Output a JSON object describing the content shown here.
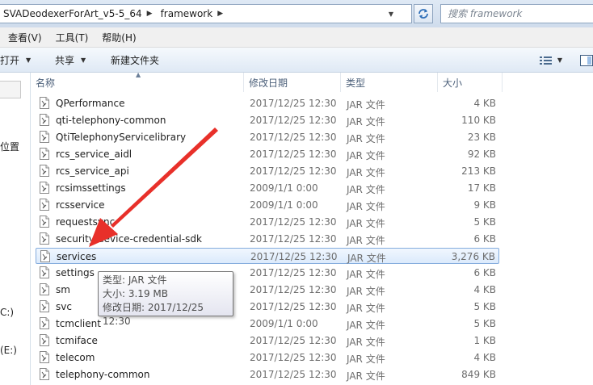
{
  "address": {
    "segments": [
      "SVADeodexerForArt_v5-5_64",
      "framework"
    ],
    "search_placeholder": "搜索 framework"
  },
  "menu": [
    "查看(V)",
    "工具(T)",
    "帮助(H)"
  ],
  "toolbar": {
    "open_label": "打开",
    "share_label": "共享",
    "new_folder_label": "新建文件夹"
  },
  "nav": {
    "partial_labels": [
      "位置",
      "C:)",
      "(E:)"
    ]
  },
  "columns": {
    "name": "名称",
    "date": "修改日期",
    "type": "类型",
    "size": "大小"
  },
  "files": [
    {
      "name": "QPerformance",
      "date": "2017/12/25 12:30",
      "type": "JAR 文件",
      "size": "4 KB"
    },
    {
      "name": "qti-telephony-common",
      "date": "2017/12/25 12:30",
      "type": "JAR 文件",
      "size": "110 KB"
    },
    {
      "name": "QtiTelephonyServicelibrary",
      "date": "2017/12/25 12:30",
      "type": "JAR 文件",
      "size": "23 KB"
    },
    {
      "name": "rcs_service_aidl",
      "date": "2017/12/25 12:30",
      "type": "JAR 文件",
      "size": "92 KB"
    },
    {
      "name": "rcs_service_api",
      "date": "2017/12/25 12:30",
      "type": "JAR 文件",
      "size": "213 KB"
    },
    {
      "name": "rcsimssettings",
      "date": "2009/1/1 0:00",
      "type": "JAR 文件",
      "size": "17 KB"
    },
    {
      "name": "rcsservice",
      "date": "2009/1/1 0:00",
      "type": "JAR 文件",
      "size": "9 KB"
    },
    {
      "name": "requestsync",
      "date": "2017/12/25 12:30",
      "type": "JAR 文件",
      "size": "5 KB"
    },
    {
      "name": "security-device-credential-sdk",
      "date": "2017/12/25 12:30",
      "type": "JAR 文件",
      "size": "6 KB"
    },
    {
      "name": "services",
      "date": "2017/12/25 12:30",
      "type": "JAR 文件",
      "size": "3,276 KB"
    },
    {
      "name": "settings",
      "date": "2017/12/25 12:30",
      "type": "JAR 文件",
      "size": "6 KB"
    },
    {
      "name": "sm",
      "date": "2017/12/25 12:30",
      "type": "JAR 文件",
      "size": "4 KB"
    },
    {
      "name": "svc",
      "date": "2017/12/25 12:30",
      "type": "JAR 文件",
      "size": "5 KB"
    },
    {
      "name": "tcmclient",
      "date": "2009/1/1 0:00",
      "type": "JAR 文件",
      "size": "5 KB"
    },
    {
      "name": "tcmiface",
      "date": "2017/12/25 12:30",
      "type": "JAR 文件",
      "size": "1 KB"
    },
    {
      "name": "telecom",
      "date": "2017/12/25 12:30",
      "type": "JAR 文件",
      "size": "4 KB"
    },
    {
      "name": "telephony-common",
      "date": "2017/12/25 12:30",
      "type": "JAR 文件",
      "size": "849 KB"
    }
  ],
  "selected_index": 9,
  "tooltip": {
    "type_line": "类型: JAR 文件",
    "size_line": "大小: 3.19 MB",
    "date_line": "修改日期: 2017/12/25 12:30"
  },
  "colors": {
    "accent_arrow": "#e8302a",
    "selection_border": "#84acdd"
  }
}
